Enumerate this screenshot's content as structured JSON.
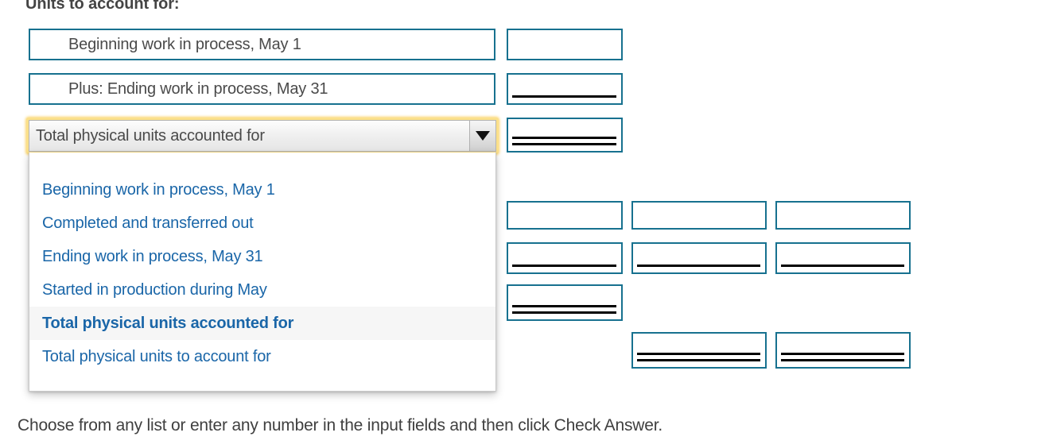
{
  "heading": "Units to account for:",
  "rows": [
    {
      "label": "Beginning work in process, May 1"
    },
    {
      "label": "Plus: Ending work in process, May 31"
    }
  ],
  "combobox": {
    "selected_value": "Total physical units accounted for",
    "arrow_icon": "chevron-down-icon",
    "expanded": true,
    "focus_ring_color": "#fbe08a",
    "options": [
      {
        "label": "Beginning work in process, May 1",
        "selected": false
      },
      {
        "label": "Completed and transferred out",
        "selected": false
      },
      {
        "label": "Ending work in process, May 31",
        "selected": false
      },
      {
        "label": "Started in production during May",
        "selected": false
      },
      {
        "label": "Total physical units accounted for",
        "selected": true
      },
      {
        "label": "Total physical units to account for",
        "selected": false
      }
    ]
  },
  "input_boxes": [
    {
      "id": "units-row1-col1",
      "value": "",
      "rule": "none"
    },
    {
      "id": "units-row2-col1",
      "value": "",
      "rule": "single"
    },
    {
      "id": "units-total-col1",
      "value": "",
      "rule": "double"
    },
    {
      "id": "eq-row1-col1",
      "value": "",
      "rule": "none"
    },
    {
      "id": "eq-row1-col2",
      "value": "",
      "rule": "none"
    },
    {
      "id": "eq-row1-col3",
      "value": "",
      "rule": "none"
    },
    {
      "id": "eq-row2-col1",
      "value": "",
      "rule": "single"
    },
    {
      "id": "eq-row2-col2",
      "value": "",
      "rule": "single"
    },
    {
      "id": "eq-row2-col3",
      "value": "",
      "rule": "single"
    },
    {
      "id": "eq-row3-col1",
      "value": "",
      "rule": "double"
    },
    {
      "id": "eq-row4-col2",
      "value": "",
      "rule": "double"
    },
    {
      "id": "eq-row4-col3",
      "value": "",
      "rule": "double"
    }
  ],
  "footer_note": "Choose from any list or enter any number in the input fields and then click Check Answer.",
  "colors": {
    "input_border": "#17718f",
    "option_text": "#1a66a8",
    "label_text": "#4a4a4a",
    "focus_ring": "#fbe08a",
    "selected_option_bg": "#f6f6f6"
  }
}
